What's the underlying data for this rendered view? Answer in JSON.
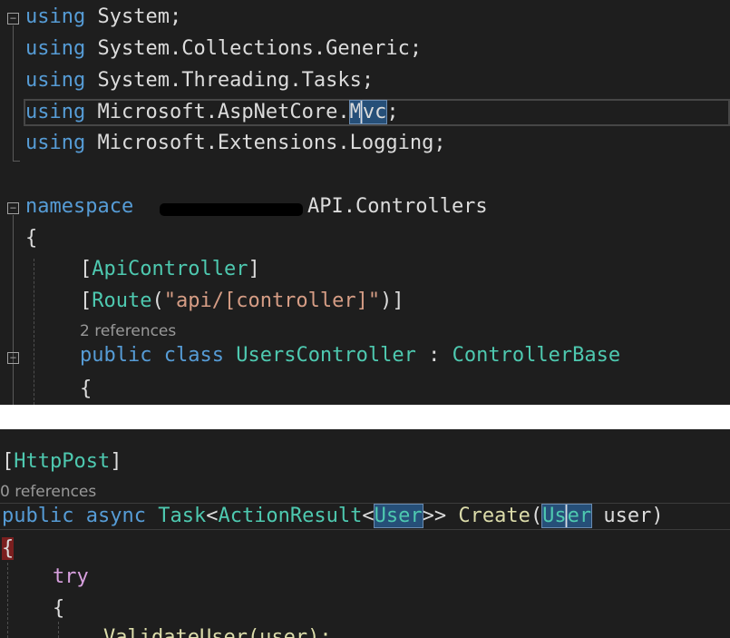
{
  "top_panel": {
    "usings": [
      {
        "keyword": "using",
        "namespace": "System;"
      },
      {
        "keyword": "using",
        "namespace": "System.Collections.Generic;"
      },
      {
        "keyword": "using",
        "namespace": "System.Threading.Tasks;"
      },
      {
        "keyword": "using",
        "namespace_before": "Microsoft.AspNetCore.",
        "hl_a": "M",
        "hl_b": "vc",
        "after": ";"
      },
      {
        "keyword": "using",
        "namespace": "Microsoft.Extensions.Logging;"
      }
    ],
    "namespace": {
      "keyword": "namespace",
      "name_suffix": "API.Controllers"
    },
    "open_brace": "{",
    "attr_api": {
      "open": "[",
      "type": "ApiController",
      "close": "]"
    },
    "attr_route": {
      "open": "[",
      "type": "Route",
      "paren_open": "(",
      "string": "\"api/[controller]\"",
      "paren_close": ")]"
    },
    "class_refs": "2 references",
    "class_decl": {
      "mod1": "public",
      "mod2": "class",
      "name": "UsersController",
      "colon": " : ",
      "base": "ControllerBase"
    },
    "class_brace": "{"
  },
  "bottom_panel": {
    "attr_post": {
      "open": "[",
      "type": "HttpPost",
      "close": "]"
    },
    "method_refs": "0 references",
    "method_sig": {
      "mod1": "public",
      "mod2": "async",
      "task": "Task",
      "lt1": "<",
      "action_result": "ActionResult",
      "lt2": "<",
      "user_type": "User",
      "gt": ">>",
      "method": "Create",
      "paren_open": "(",
      "param_type_a": "Us",
      "param_type_b": "er",
      "param_name": " user",
      "paren_close": ")"
    },
    "method_brace": "{",
    "try_kw": "try",
    "try_brace": "{",
    "call_line": "ValidateUser(user);"
  }
}
